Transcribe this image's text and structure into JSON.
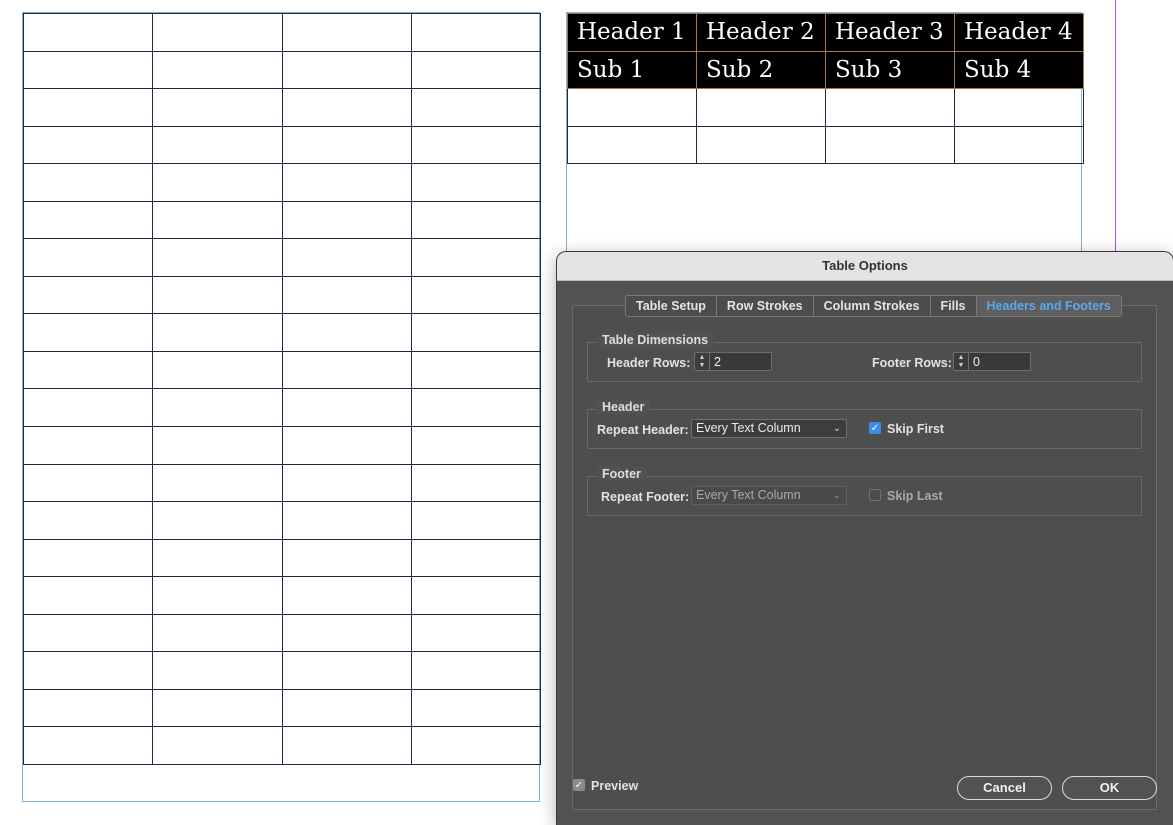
{
  "document": {
    "right_table": {
      "header_rows": [
        [
          "Header 1",
          "Header 2",
          "Header 3",
          "Header 4"
        ],
        [
          "Sub 1",
          "Sub 2",
          "Sub 3",
          "Sub 4"
        ]
      ],
      "body_row_count": 2
    },
    "left_table": {
      "row_count": 20,
      "column_count": 4
    }
  },
  "dialog": {
    "title": "Table Options",
    "tabs": [
      {
        "label": "Table Setup",
        "active": false
      },
      {
        "label": "Row Strokes",
        "active": false
      },
      {
        "label": "Column Strokes",
        "active": false
      },
      {
        "label": "Fills",
        "active": false
      },
      {
        "label": "Headers and Footers",
        "active": true
      }
    ],
    "table_dimensions": {
      "group_label": "Table Dimensions",
      "header_rows_label": "Header Rows:",
      "header_rows_value": "2",
      "footer_rows_label": "Footer Rows:",
      "footer_rows_value": "0"
    },
    "header": {
      "group_label": "Header",
      "repeat_label": "Repeat Header:",
      "repeat_value": "Every Text Column",
      "skip_label": "Skip First",
      "skip_checked": true
    },
    "footer": {
      "group_label": "Footer",
      "repeat_label": "Repeat Footer:",
      "repeat_value": "Every Text Column",
      "skip_label": "Skip Last",
      "skip_checked": false
    },
    "preview_label": "Preview",
    "preview_checked": true,
    "cancel_label": "Cancel",
    "ok_label": "OK",
    "colors": {
      "accent": "#3b8ee8",
      "active_tab_text": "#5aa9f0",
      "panel_bg": "#525252",
      "header_cell_bg": "#000000"
    },
    "icons": {
      "stepper": "up-down-stepper-icon",
      "dropdown": "chevron-down-icon",
      "check": "checkmark-icon"
    }
  }
}
